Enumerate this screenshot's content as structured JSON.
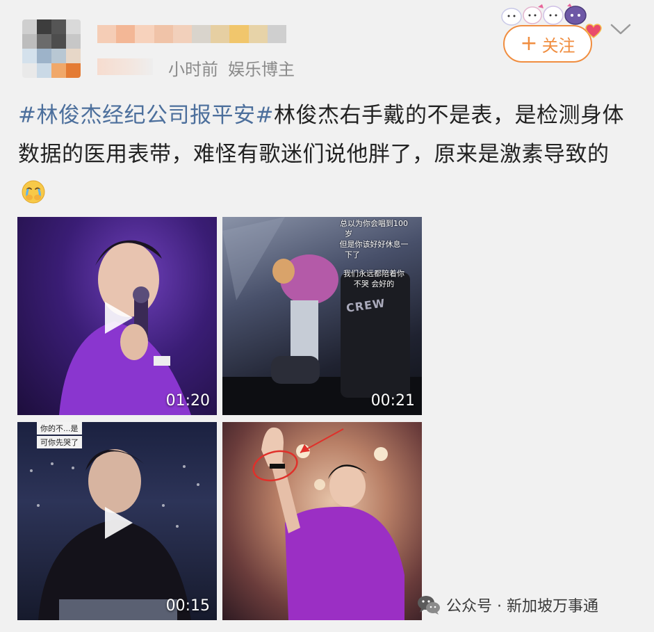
{
  "header": {
    "meta": {
      "time_ago": "小时前",
      "category": "娱乐博主"
    },
    "follow_button": {
      "plus": "+",
      "label": "关注"
    }
  },
  "post": {
    "hashtag": "#林俊杰经纪公司报平安#",
    "body": "林俊杰右手戴的不是表，是检测身体数据的医用表带，难怪有歌迷们说他胖了，原来是激素导致的"
  },
  "media": [
    {
      "type": "video",
      "duration": "01:20"
    },
    {
      "type": "video",
      "duration": "00:21",
      "subtitles": [
        "总以为你会唱到100",
        "岁",
        "但是你该好好休息一",
        "下了",
        "",
        "我们永远都陪着你",
        "不哭 会好的"
      ],
      "sign_text": "CREW"
    },
    {
      "type": "video",
      "duration": "00:15",
      "top_tags": [
        "你的不...是",
        "可你先哭了"
      ]
    },
    {
      "type": "image"
    }
  ],
  "watermark": {
    "text": "公众号 · 新加坡万事通"
  },
  "colors": {
    "accent_orange": "#f08d3f",
    "hashtag_blue": "#4c6f9c",
    "meta_gray": "#8a8a8a",
    "background": "#f1f1f1"
  },
  "icons": [
    "play-icon",
    "chevron-down-icon",
    "wechat-icon",
    "crying-face-emoji",
    "heart-badge-icon"
  ]
}
